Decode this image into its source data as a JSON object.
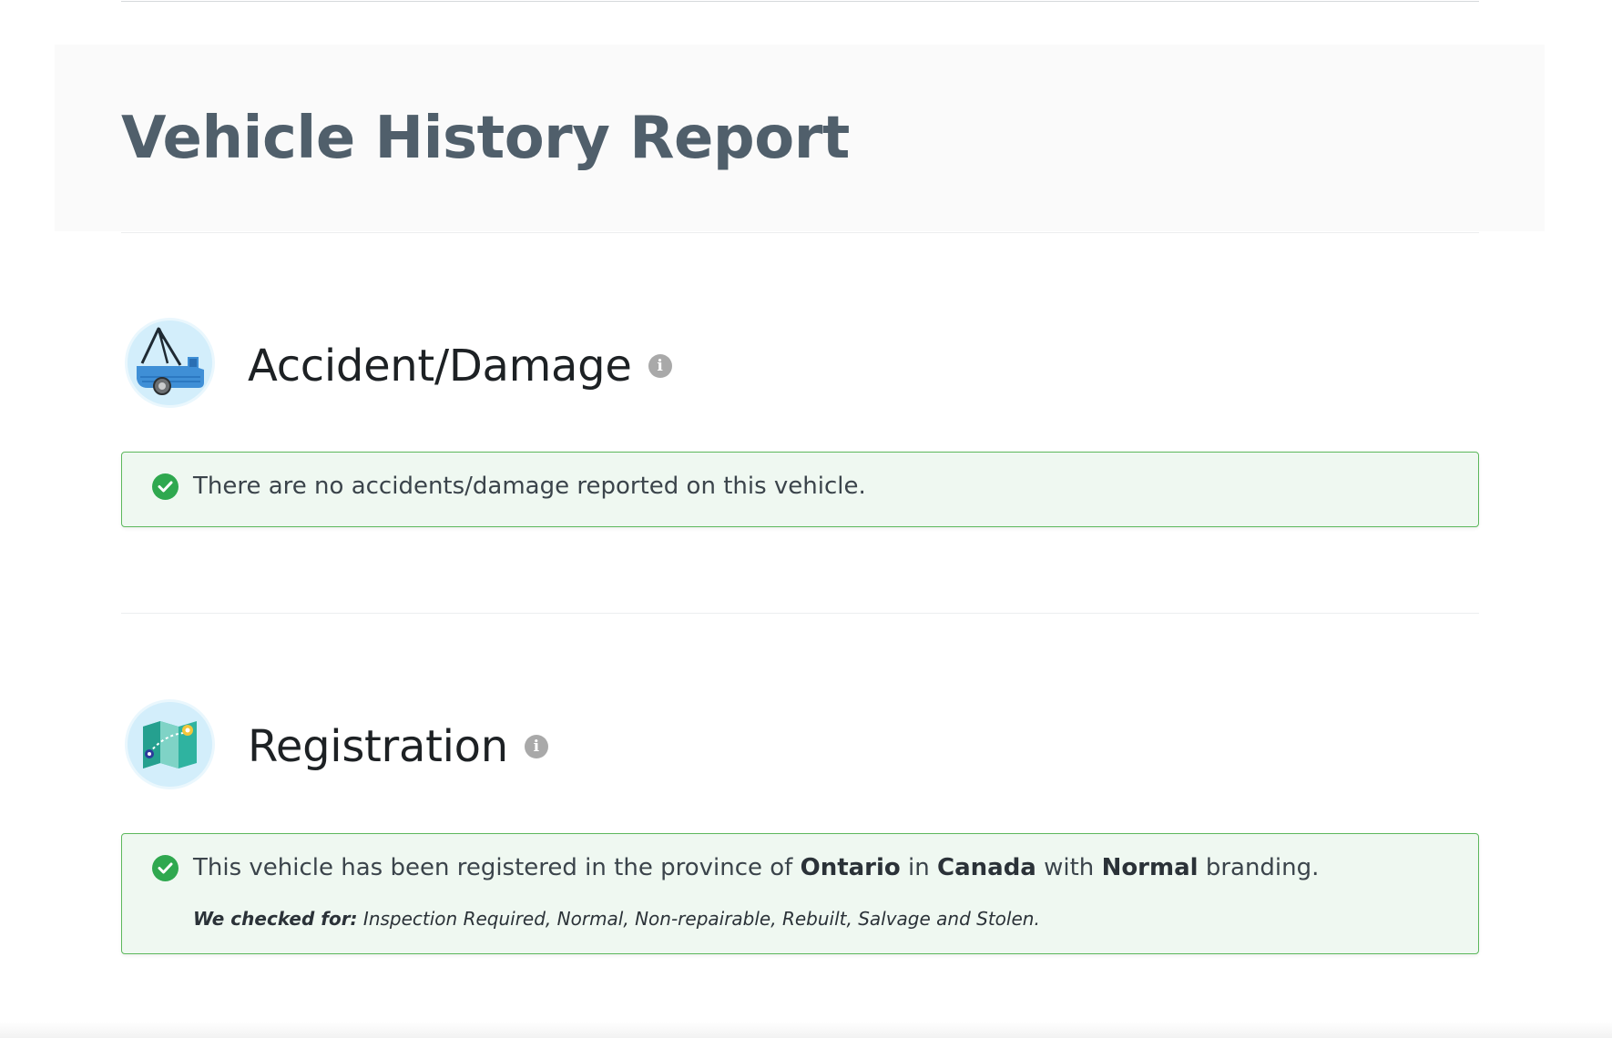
{
  "report": {
    "title": "Vehicle History Report"
  },
  "accident_section": {
    "heading": "Accident/Damage",
    "icon": "tow-truck-icon",
    "info_glyph": "i",
    "message": "There are no accidents/damage reported on this vehicle."
  },
  "registration_section": {
    "heading": "Registration",
    "icon": "map-icon",
    "info_glyph": "i",
    "message_prefix": "This vehicle has been registered in the province of",
    "province": "Ontario",
    "in_word": "in",
    "country": "Canada",
    "with_word": "with",
    "branding": "Normal",
    "message_suffix": "branding.",
    "checked_label": "We checked for:",
    "checked_items": "Inspection Required, Normal, Non-repairable, Rebuilt, Salvage and Stolen."
  },
  "colors": {
    "success_border": "#5cb85c",
    "success_background": "#eff8f1",
    "check_green": "#2fa84f",
    "title_color": "#505f6b",
    "info_grey": "#a9a9a9"
  }
}
